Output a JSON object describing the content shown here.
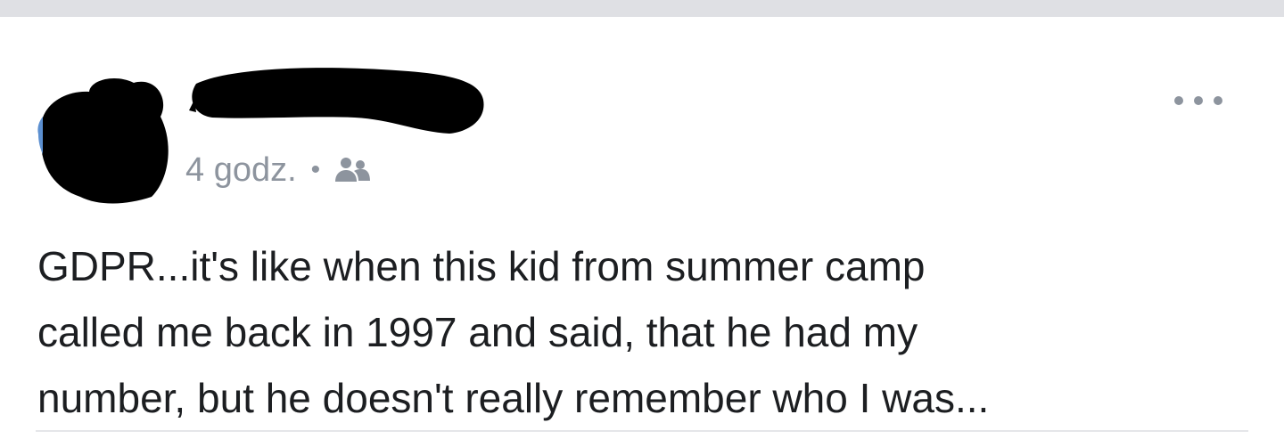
{
  "post": {
    "timestamp": "4 godz.",
    "separator": "•",
    "audience_icon": "friends-icon",
    "more_icon": "more-options-icon",
    "text": "GDPR...it's like when this kid from summer camp\ncalled me back in 1997 and said, that he had my\nnumber, but he doesn't really remember who I was..."
  },
  "colors": {
    "meta_gray": "#8d949e",
    "text": "#1c1e21",
    "redaction": "#000000",
    "top_strip": "#dfe0e4"
  }
}
